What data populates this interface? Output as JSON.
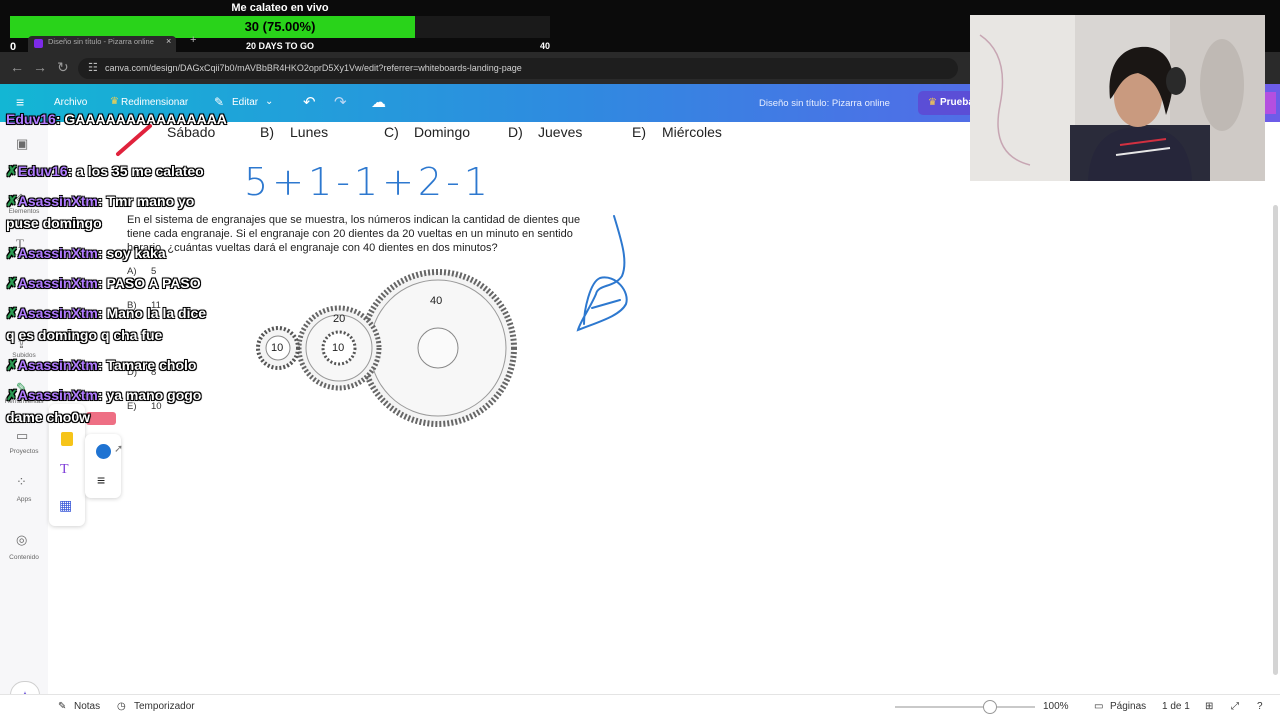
{
  "stream_goal": {
    "title": "Me calateo en vivo",
    "progress_text": "30 (75.00%)",
    "progress": 0.75,
    "left_value": "0",
    "caption": "20 DAYS TO GO",
    "right_value": "40",
    "fill_color": "#29d31a"
  },
  "browser": {
    "tab_title": "Diseño sin título - Pizarra online",
    "tab_close": "×",
    "new_tab": "+",
    "back": "←",
    "forward": "→",
    "reload": "↻",
    "url": "canva.com/design/DAGxCqii7b0/mAVBbBR4HKO2oprD5Xy1Vw/edit?referrer=whiteboards-landing-page"
  },
  "canva_toolbar": {
    "menu_icon": "≡",
    "archivo": "Archivo",
    "redimensionar": "Redimensionar",
    "editar": "Editar",
    "doc_title": "Diseño sin título: Pizarra online",
    "trial_label": "Prueba",
    "brand_gradient": [
      "#13b6d4",
      "#6d5ce8"
    ]
  },
  "sidebar": {
    "items": [
      {
        "label": "Elementos"
      },
      {
        "label": "Texto"
      },
      {
        "label": "Subidos"
      },
      {
        "label": "Herramientas"
      },
      {
        "label": "Proyectos"
      },
      {
        "label": "Apps"
      },
      {
        "label": "Contenido"
      }
    ]
  },
  "worksheet": {
    "options_row": [
      {
        "letter": "B)",
        "text": "Lunes"
      },
      {
        "letter": "C)",
        "text": "Domingo"
      },
      {
        "letter": "D)",
        "text": "Jueves"
      },
      {
        "letter": "E)",
        "text": "Miércoles"
      }
    ],
    "first_option": "Sábado",
    "handwriting": "5+1-1+2-1",
    "question_lines": [
      "En el sistema de engranajes que se muestra, los números indican la cantidad de dientes que",
      "tiene cada engranaje. Si el engranaje con 20 dientes da 20 vueltas en un minuto en sentido",
      "horario, ¿cuántas vueltas dará el engranaje con 40 dientes en dos minutos?"
    ],
    "answers": [
      {
        "letter": "A)",
        "value": "5"
      },
      {
        "letter": "B)",
        "value": "11"
      },
      {
        "letter": "D)",
        "value": "8"
      },
      {
        "letter": "E)",
        "value": "10"
      }
    ],
    "gears": {
      "small_a": "10",
      "small_b": "10",
      "medium": "20",
      "large": "40"
    },
    "ink_color": "#2d78cf"
  },
  "chat": [
    {
      "user": "Eduv16",
      "message": "GAAAAAAAAAAAAAAA"
    },
    {
      "user": "Eduv16",
      "message": "a los 35 me calateo"
    },
    {
      "user": "AsassinXtm",
      "message": "Tmr mano yo",
      "line2": "puse domingo"
    },
    {
      "user": "AsassinXtm",
      "message": "soy kaka"
    },
    {
      "user": "AsassinXtm",
      "message": "PASO A PASO"
    },
    {
      "user": "AsassinXtm",
      "message": "Mano la la dice",
      "line2": "q es domingo q cha fue"
    },
    {
      "user": "AsassinXtm",
      "message": "Tamare cholo"
    },
    {
      "user": "AsassinXtm",
      "message": "ya mano gogo",
      "line2": "dame cho0w"
    }
  ],
  "bottom_bar": {
    "notes": "Notas",
    "timer": "Temporizador",
    "zoom_value": "100%",
    "zoom_level": 1.0,
    "pages_label": "Páginas",
    "page_count": "1 de 1",
    "help": "?"
  },
  "icons": {
    "draw_color": "#1f73d2",
    "highlighter_color": "#f6c419",
    "eraser_color": "#ee6f84"
  }
}
